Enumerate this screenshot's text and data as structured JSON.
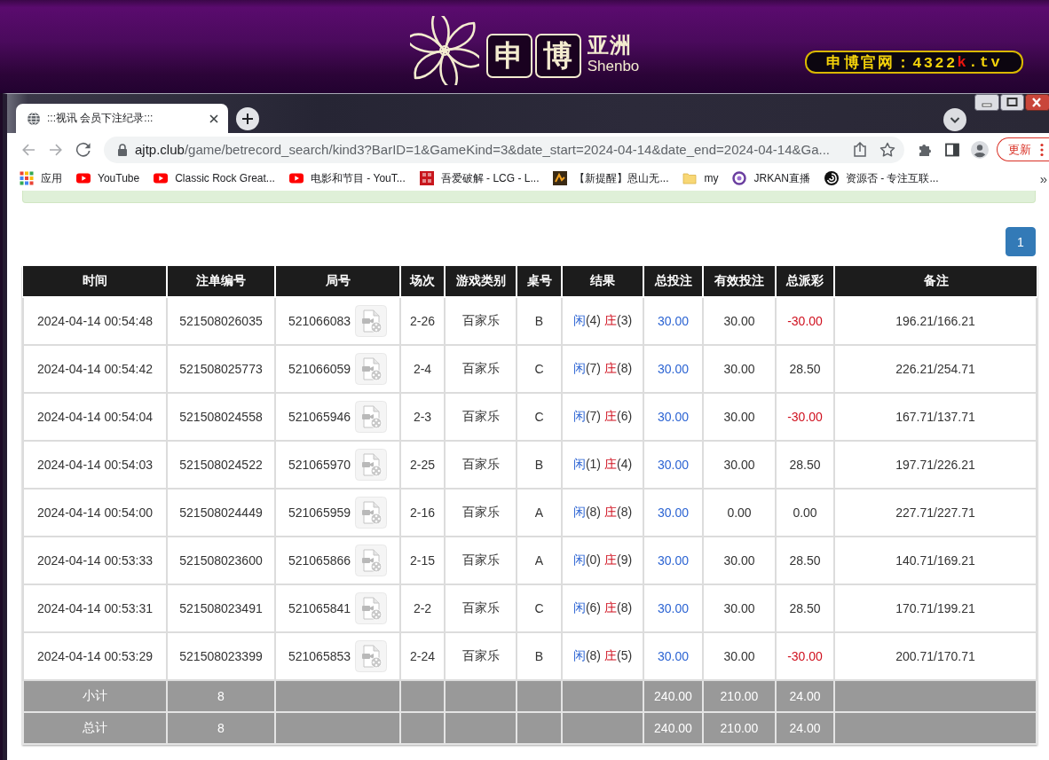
{
  "banner": {
    "logo_characters": [
      "申",
      "博"
    ],
    "logo_region": "亚洲",
    "logo_latin": "Shenbo",
    "site_badge": [
      {
        "text": "申博官网：4322",
        "highlight": false
      },
      {
        "text": "k",
        "highlight": true
      },
      {
        "text": ".tv",
        "highlight": false
      }
    ]
  },
  "browser": {
    "tabs": [
      {
        "title": ":::视讯 会员下注纪录:::",
        "selected": true
      }
    ],
    "nav_buttons": [
      {
        "kind": "back",
        "disabled": true
      },
      {
        "kind": "forward",
        "disabled": true
      },
      {
        "kind": "reload",
        "disabled": false
      }
    ],
    "address": {
      "host": "ajtp.club",
      "path": "/game/betrecord_search/kind3?BarID=1&GameKind=3&date_start=2024-04-14&date_end=2024-04-14&Ga..."
    },
    "update_button": "更新",
    "bookmarks": [
      {
        "kind": "apps",
        "label": "应用"
      },
      {
        "kind": "youtube",
        "label": "YouTube"
      },
      {
        "kind": "youtube",
        "label": "Classic Rock Great..."
      },
      {
        "kind": "youtube",
        "label": "电影和节目 - YouT..."
      },
      {
        "kind": "stamp",
        "label": "吾爱破解 - LCG - L..."
      },
      {
        "kind": "mosaic",
        "label": "【新提醒】恩山无..."
      },
      {
        "kind": "folder",
        "label": "my"
      },
      {
        "kind": "ring",
        "label": "JRKAN直播"
      },
      {
        "kind": "swirl",
        "label": "资源否 - 专注互联..."
      }
    ],
    "bookmarks_overflow": "»"
  },
  "page": {
    "pagination": [
      {
        "label": "1",
        "selected": true
      }
    ],
    "table": {
      "columns": [
        "时间",
        "注单编号",
        "局号",
        "场次",
        "游戏类别",
        "桌号",
        "结果",
        "总投注",
        "有效投注",
        "总派彩",
        "备注"
      ],
      "rows": [
        {
          "time": "2024-04-14 00:54:48",
          "bet_id": "521508026035",
          "round_id": "521066083",
          "shoe": "2-26",
          "game": "百家乐",
          "table": "B",
          "result": [
            {
              "kind": "player",
              "label": "闲",
              "score": "(4)"
            },
            {
              "kind": "banker",
              "label": "庄",
              "score": "(3)"
            }
          ],
          "total_bet": "30.00",
          "valid_bet": "30.00",
          "payout": "-30.00",
          "loss": true,
          "note": "196.21/166.21"
        },
        {
          "time": "2024-04-14 00:54:42",
          "bet_id": "521508025773",
          "round_id": "521066059",
          "shoe": "2-4",
          "game": "百家乐",
          "table": "C",
          "result": [
            {
              "kind": "player",
              "label": "闲",
              "score": "(7)"
            },
            {
              "kind": "banker",
              "label": "庄",
              "score": "(8)"
            }
          ],
          "total_bet": "30.00",
          "valid_bet": "30.00",
          "payout": "28.50",
          "loss": false,
          "note": "226.21/254.71"
        },
        {
          "time": "2024-04-14 00:54:04",
          "bet_id": "521508024558",
          "round_id": "521065946",
          "shoe": "2-3",
          "game": "百家乐",
          "table": "C",
          "result": [
            {
              "kind": "player",
              "label": "闲",
              "score": "(7)"
            },
            {
              "kind": "banker",
              "label": "庄",
              "score": "(6)"
            }
          ],
          "total_bet": "30.00",
          "valid_bet": "30.00",
          "payout": "-30.00",
          "loss": true,
          "note": "167.71/137.71"
        },
        {
          "time": "2024-04-14 00:54:03",
          "bet_id": "521508024522",
          "round_id": "521065970",
          "shoe": "2-25",
          "game": "百家乐",
          "table": "B",
          "result": [
            {
              "kind": "player",
              "label": "闲",
              "score": "(1)"
            },
            {
              "kind": "banker",
              "label": "庄",
              "score": "(4)"
            }
          ],
          "total_bet": "30.00",
          "valid_bet": "30.00",
          "payout": "28.50",
          "loss": false,
          "note": "197.71/226.21"
        },
        {
          "time": "2024-04-14 00:54:00",
          "bet_id": "521508024449",
          "round_id": "521065959",
          "shoe": "2-16",
          "game": "百家乐",
          "table": "A",
          "result": [
            {
              "kind": "player",
              "label": "闲",
              "score": "(8)"
            },
            {
              "kind": "banker",
              "label": "庄",
              "score": "(8)"
            }
          ],
          "total_bet": "30.00",
          "valid_bet": "0.00",
          "payout": "0.00",
          "loss": false,
          "note": "227.71/227.71"
        },
        {
          "time": "2024-04-14 00:53:33",
          "bet_id": "521508023600",
          "round_id": "521065866",
          "shoe": "2-15",
          "game": "百家乐",
          "table": "A",
          "result": [
            {
              "kind": "player",
              "label": "闲",
              "score": "(0)"
            },
            {
              "kind": "banker",
              "label": "庄",
              "score": "(9)"
            }
          ],
          "total_bet": "30.00",
          "valid_bet": "30.00",
          "payout": "28.50",
          "loss": false,
          "note": "140.71/169.21"
        },
        {
          "time": "2024-04-14 00:53:31",
          "bet_id": "521508023491",
          "round_id": "521065841",
          "shoe": "2-2",
          "game": "百家乐",
          "table": "C",
          "result": [
            {
              "kind": "player",
              "label": "闲",
              "score": "(6)"
            },
            {
              "kind": "banker",
              "label": "庄",
              "score": "(8)"
            }
          ],
          "total_bet": "30.00",
          "valid_bet": "30.00",
          "payout": "28.50",
          "loss": false,
          "note": "170.71/199.21"
        },
        {
          "time": "2024-04-14 00:53:29",
          "bet_id": "521508023399",
          "round_id": "521065853",
          "shoe": "2-24",
          "game": "百家乐",
          "table": "B",
          "result": [
            {
              "kind": "player",
              "label": "闲",
              "score": "(8)"
            },
            {
              "kind": "banker",
              "label": "庄",
              "score": "(5)"
            }
          ],
          "total_bet": "30.00",
          "valid_bet": "30.00",
          "payout": "-30.00",
          "loss": true,
          "note": "200.71/170.71"
        }
      ],
      "summary_rows": [
        {
          "label": "小计",
          "count": "8",
          "total_bet": "240.00",
          "valid_bet": "210.00",
          "payout": "24.00"
        },
        {
          "label": "总计",
          "count": "8",
          "total_bet": "240.00",
          "valid_bet": "210.00",
          "payout": "24.00"
        }
      ]
    }
  }
}
